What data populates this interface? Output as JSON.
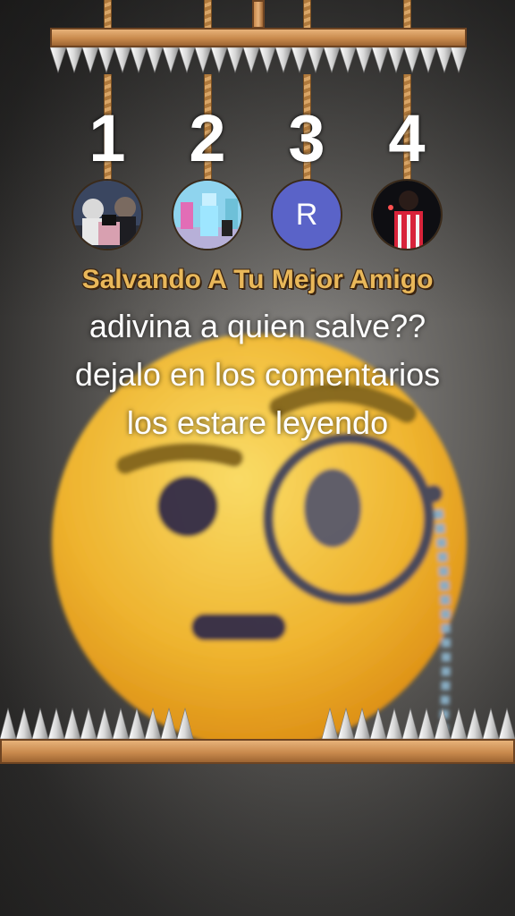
{
  "game": {
    "title": "Salvando A Tu Mejor Amigo",
    "slots": [
      {
        "number": "1",
        "avatar": "photo-avatar"
      },
      {
        "number": "2",
        "avatar": "photo-avatar"
      },
      {
        "number": "3",
        "avatar": "letter-avatar",
        "letter": "R"
      },
      {
        "number": "4",
        "avatar": "photo-avatar"
      }
    ]
  },
  "captions": {
    "line1": "adivina a quien salve??",
    "line2": "dejalo en los comentarios",
    "line3": "los estare leyendo"
  },
  "colors": {
    "wood": "#c98a4d",
    "title": "#e9b85a",
    "letter_avatar": "#5a63c8",
    "emoji_face": "#f5b82e"
  },
  "icons": {
    "overlay": "monocle-face-emoji"
  }
}
